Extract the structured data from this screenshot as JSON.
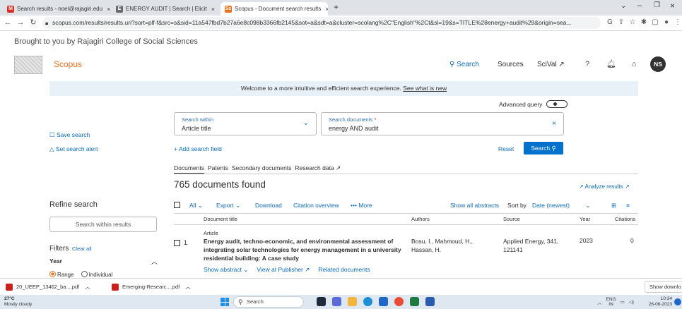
{
  "browser": {
    "tabs": [
      {
        "label": "Search results - noel@rajagiri.edu",
        "favicon": "gmail-icon",
        "color": "#d93025"
      },
      {
        "label": "ENERGY AUDIT | Search | Elicit",
        "favicon": "elicit-icon",
        "color": "#6b6b6b"
      },
      {
        "label": "Scopus - Document search results",
        "favicon": "scopus-icon",
        "color": "#e9711c"
      }
    ],
    "new_tab": "+",
    "url": "scopus.com/results/results.uri?sort=plf-f&src=s&sid=11a547fbd7b27a6e8c098b3366fb2145&sot=a&sdt=a&cluster=scolang%2C\"English\"%2Ct&sl=19&s=TITLE%28energy+audit%29&origin=sea..."
  },
  "header": {
    "brought": "Brought to you by Rajagiri College of Social Sciences",
    "brand": "Scopus",
    "nav": {
      "search": "Search",
      "sources": "Sources",
      "scival": "SciVal ↗"
    },
    "avatar": "NS"
  },
  "banner": {
    "text": "Welcome to a more intuitive and efficient search experience.",
    "link": "See what is new"
  },
  "advanced_query": "Advanced query",
  "search_within": {
    "label": "Search within",
    "value": "Article title"
  },
  "search_documents": {
    "label": "Search documents",
    "required_mark": "*",
    "value": "energy AND audit"
  },
  "actions": {
    "save_search": "Save search",
    "set_alert": "Set search alert",
    "add_field": "+ Add search field",
    "reset": "Reset",
    "search": "Search"
  },
  "doc_tabs": [
    "Documents",
    "Patents",
    "Secondary documents",
    "Research data ↗"
  ],
  "results": {
    "count": "765 documents found",
    "analyze": "Analyze results ↗",
    "toolbar": {
      "all": "All",
      "export": "Export",
      "download": "Download",
      "citation": "Citation overview",
      "more": "More",
      "show_abstracts": "Show all abstracts",
      "sort_by": "Sort by",
      "sort_value": "Date (newest)"
    },
    "columns": [
      "Document title",
      "Authors",
      "Source",
      "Year",
      "Citations"
    ],
    "rows": [
      {
        "num": "1",
        "type": "Article",
        "title": "Energy audit, techno-economic, and environmental assessment of integrating solar technologies for energy management in a university residential building: A case study",
        "authors": "Bosu, I., Mahmoud, H., Hassan, H.",
        "source": "Applied Energy, 341, 121141",
        "year": "2023",
        "citations": "0",
        "links": {
          "abstract": "Show abstract",
          "publisher": "View at Publisher ↗",
          "related": "Related documents"
        }
      }
    ]
  },
  "refine": {
    "title": "Refine search",
    "within_placeholder": "Search within results",
    "filters": "Filters",
    "clear": "Clear all",
    "year": "Year",
    "radio_range": "Range",
    "radio_individual": "Individual"
  },
  "downloads": [
    {
      "name": "20_UEEP_13462_ba....pdf"
    },
    {
      "name": "Emerging-Researc....pdf"
    }
  ],
  "show_downloads": "Show downlo",
  "taskbar": {
    "temp": "27°C",
    "weather": "Mostly cloudy",
    "search": "Search",
    "lang": "ENG",
    "region": "IN",
    "time": "10:34",
    "date": "26-06-2023"
  }
}
